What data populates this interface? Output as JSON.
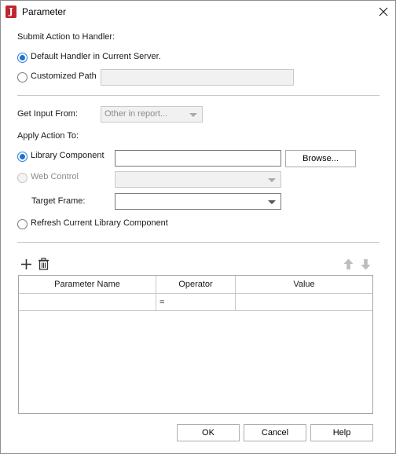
{
  "window": {
    "title": "Parameter",
    "app_icon_letter": "J"
  },
  "submit": {
    "heading": "Submit Action to Handler:",
    "default_handler_label": "Default Handler in Current Server.",
    "customized_path_label": "Customized Path",
    "customized_path_value": ""
  },
  "input": {
    "label": "Get Input From:",
    "selected": "Other in report..."
  },
  "apply": {
    "heading": "Apply Action To:",
    "library_component_label": "Library Component",
    "library_component_value": "",
    "browse_label": "Browse...",
    "web_control_label": "Web Control",
    "web_control_value": "",
    "target_frame_label": "Target Frame:",
    "target_frame_value": "",
    "refresh_label": "Refresh Current Library Component"
  },
  "table": {
    "columns": [
      "Parameter Name",
      "Operator",
      "Value"
    ],
    "rows": [
      {
        "name": "",
        "operator": "=",
        "value": ""
      }
    ]
  },
  "footer": {
    "ok": "OK",
    "cancel": "Cancel",
    "help": "Help"
  },
  "colors": {
    "accent": "#1e73d2",
    "app_icon": "#c0262d"
  }
}
